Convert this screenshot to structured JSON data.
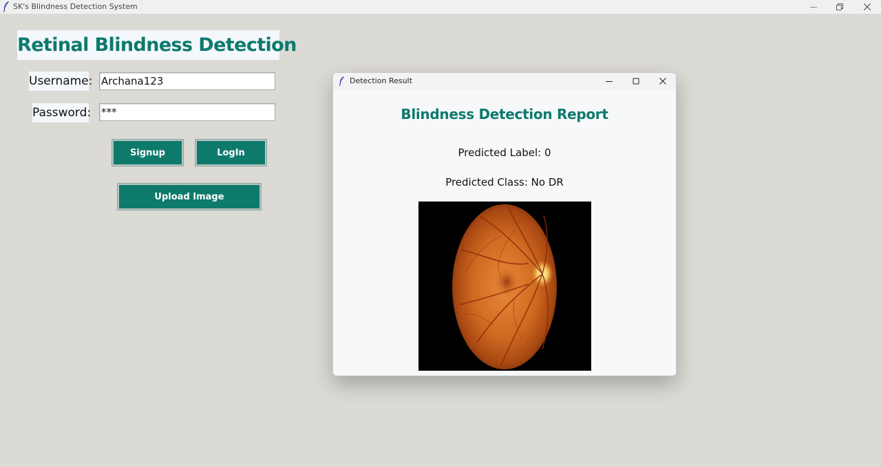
{
  "main_window": {
    "title": "SK's Blindness Detection System",
    "app_title": "Retinal Blindness Detection",
    "username_label": "Username:",
    "username_value": "Archana123",
    "password_label": "Password:",
    "password_value": "***",
    "signup_label": "Signup",
    "login_label": "LogIn",
    "upload_label": "Upload Image"
  },
  "dialog": {
    "title": "Detection Result",
    "report_title": "Blindness Detection Report",
    "predicted_label": "Predicted Label: 0",
    "predicted_class": "Predicted Class: No DR"
  },
  "colors": {
    "accent": "#0d7a6d",
    "button_bg": "#0e7a6c",
    "window_bg": "#dcdad5",
    "dialog_bg": "#f7f8fa"
  },
  "icons": {
    "app_icon": "feather-icon",
    "minimize": "minimize-icon",
    "maximize": "maximize-icon",
    "restore": "restore-icon",
    "close": "close-icon"
  }
}
